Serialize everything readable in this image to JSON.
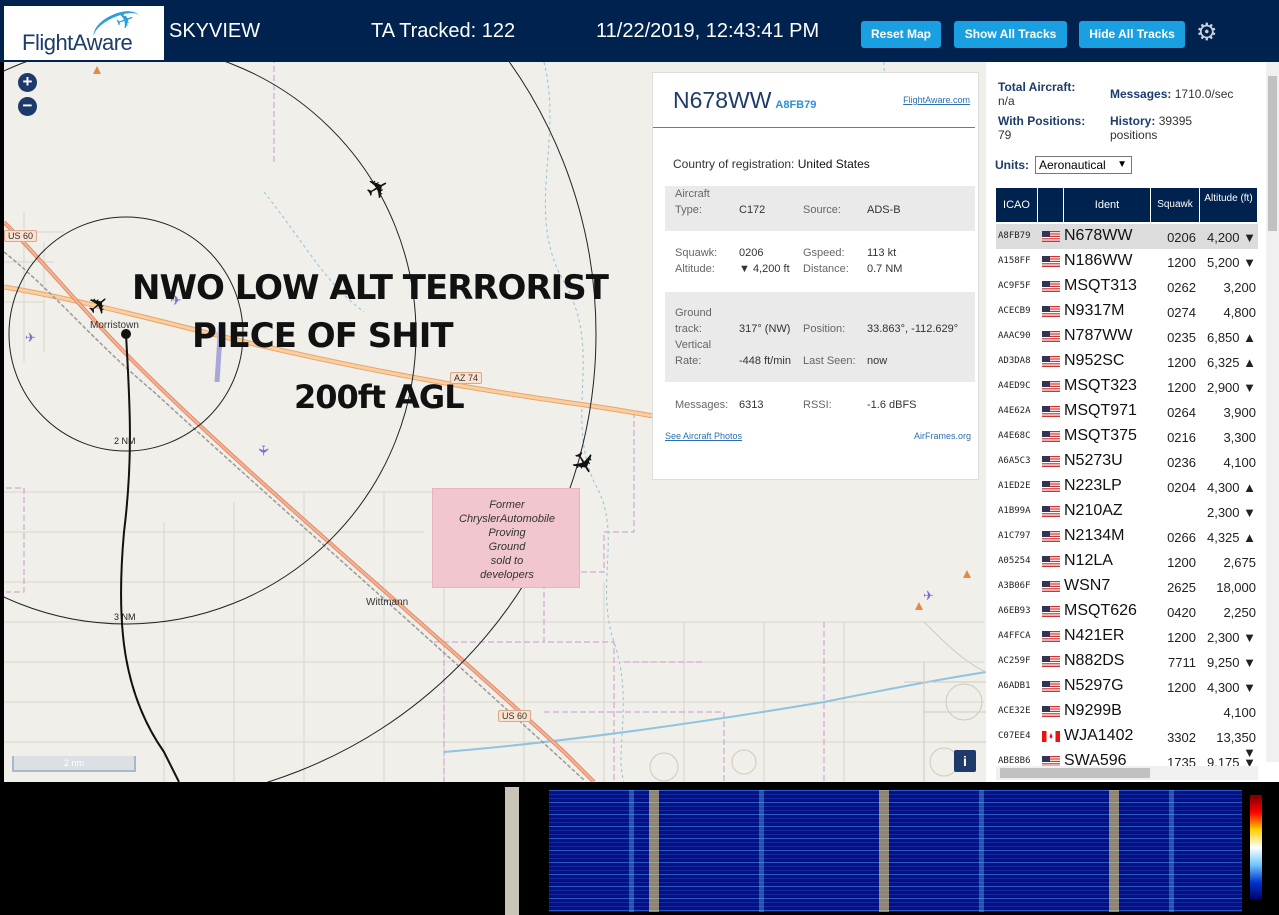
{
  "header": {
    "brand": "FlightAware",
    "site_label": "SKYVIEW",
    "tracked": "TA Tracked: 122",
    "datetime": "11/22/2019, 12:43:41 PM",
    "buttons": {
      "reset": "Reset Map",
      "show": "Show All Tracks",
      "hide": "Hide All Tracks"
    },
    "settings_icon": "gear-icon"
  },
  "map": {
    "zoom_in": "+",
    "zoom_out": "−",
    "scale": "2 nm",
    "info": "i",
    "overlay": {
      "line1": "NWO LOW ALT TERRORIST",
      "line2": "PIECE OF SHIT",
      "line3": "200ft AGL"
    },
    "labels": {
      "town1": "Morristown",
      "town2": "Wittmann",
      "ring_inner": "2 NM",
      "ring_outer": "3 NM"
    },
    "shields": {
      "us60_a": "US 60",
      "us60_b": "US 60",
      "az74": "AZ 74"
    },
    "proving": [
      "Former",
      "ChryslerAutomobile",
      "Proving",
      "Ground",
      "sold to",
      "developers"
    ]
  },
  "popup": {
    "ident": "N678WW",
    "icao": "A8FB79",
    "fa_link": "FlightAware.com",
    "country_label": "Country of registration:",
    "country": "United States",
    "aircraft_type_label": "Aircraft",
    "type_label": "Type:",
    "type": "C172",
    "source_label": "Source:",
    "source": "ADS-B",
    "squawk_label": "Squawk:",
    "squawk": "0206",
    "gspeed_label": "Gspeed:",
    "gspeed": "113 kt",
    "altitude_label": "Altitude:",
    "altitude": "▼ 4,200 ft",
    "distance_label": "Distance:",
    "distance": "0.7 NM",
    "ground_label": "Ground",
    "track_label": "track:",
    "track": "317° (NW)",
    "position_label": "Position:",
    "position": "33.863°, -112.629°",
    "vertical_label": "Vertical",
    "rate_label": "Rate:",
    "rate": "-448 ft/min",
    "lastseen_label": "Last Seen:",
    "lastseen": "now",
    "messages_label": "Messages:",
    "messages": "6313",
    "rssi_label": "RSSI:",
    "rssi": "-1.6 dBFS",
    "photos_link": "See Aircraft Photos",
    "airframes_link": "AirFrames.org"
  },
  "sidebar": {
    "total_label": "Total Aircraft:",
    "total": "n/a",
    "messages_label": "Messages:",
    "messages": "1710.0/sec",
    "positions_label": "With Positions:",
    "positions": "79",
    "history_label": "History:",
    "history": "39395 positions",
    "units_label": "Units:",
    "units": "Aeronautical",
    "columns": {
      "icao": "ICAO",
      "ident": "Ident",
      "squawk": "Squawk",
      "altitude": "Altitude (ft)"
    },
    "rows": [
      {
        "icao": "A8FB79",
        "ident": "N678WW",
        "squawk": "0206",
        "alt": "4,200 ▼",
        "flag": "us"
      },
      {
        "icao": "A158FF",
        "ident": "N186WW",
        "squawk": "1200",
        "alt": "5,200 ▼",
        "flag": "us"
      },
      {
        "icao": "AC9F5F",
        "ident": "MSQT313",
        "squawk": "0262",
        "alt": "3,200",
        "flag": "us"
      },
      {
        "icao": "ACECB9",
        "ident": "N9317M",
        "squawk": "0274",
        "alt": "4,800",
        "flag": "us"
      },
      {
        "icao": "AAAC90",
        "ident": "N787WW",
        "squawk": "0235",
        "alt": "6,850 ▲",
        "flag": "us"
      },
      {
        "icao": "AD3DA8",
        "ident": "N952SC",
        "squawk": "1200",
        "alt": "6,325 ▲",
        "flag": "us"
      },
      {
        "icao": "A4ED9C",
        "ident": "MSQT323",
        "squawk": "1200",
        "alt": "2,900 ▼",
        "flag": "us"
      },
      {
        "icao": "A4E62A",
        "ident": "MSQT971",
        "squawk": "0264",
        "alt": "3,900",
        "flag": "us"
      },
      {
        "icao": "A4E68C",
        "ident": "MSQT375",
        "squawk": "0216",
        "alt": "3,300",
        "flag": "us"
      },
      {
        "icao": "A6A5C3",
        "ident": "N5273U",
        "squawk": "0236",
        "alt": "4,100",
        "flag": "us"
      },
      {
        "icao": "A1ED2E",
        "ident": "N223LP",
        "squawk": "0204",
        "alt": "4,300 ▲",
        "flag": "us"
      },
      {
        "icao": "A1B99A",
        "ident": "N210AZ",
        "squawk": "",
        "alt": "2,300 ▼",
        "flag": "us"
      },
      {
        "icao": "A1C797",
        "ident": "N2134M",
        "squawk": "0266",
        "alt": "4,325 ▲",
        "flag": "us"
      },
      {
        "icao": "A05254",
        "ident": "N12LA",
        "squawk": "1200",
        "alt": "2,675",
        "flag": "us"
      },
      {
        "icao": "A3B06F",
        "ident": "WSN7",
        "squawk": "2625",
        "alt": "18,000",
        "flag": "us"
      },
      {
        "icao": "A6EB93",
        "ident": "MSQT626",
        "squawk": "0420",
        "alt": "2,250",
        "flag": "us"
      },
      {
        "icao": "A4FFCA",
        "ident": "N421ER",
        "squawk": "1200",
        "alt": "2,300 ▼",
        "flag": "us"
      },
      {
        "icao": "AC259F",
        "ident": "N882DS",
        "squawk": "7711",
        "alt": "9,250 ▼",
        "flag": "us"
      },
      {
        "icao": "A6ADB1",
        "ident": "N5297G",
        "squawk": "1200",
        "alt": "4,300 ▼",
        "flag": "us"
      },
      {
        "icao": "ACE32E",
        "ident": "N9299B",
        "squawk": "",
        "alt": "4,100",
        "flag": "us"
      },
      {
        "icao": "C07EE4",
        "ident": "WJA1402",
        "squawk": "3302",
        "alt": "13,350 ▼",
        "flag": "ca"
      },
      {
        "icao": "ABE8B6",
        "ident": "SWA596",
        "squawk": "1735",
        "alt": "9,175 ▼",
        "flag": "us"
      }
    ]
  },
  "colors": {
    "header_bg": "#00224e",
    "button_bg": "#1aa0e1",
    "map_bg": "#f0efe9",
    "highway": "#f7b26a"
  }
}
